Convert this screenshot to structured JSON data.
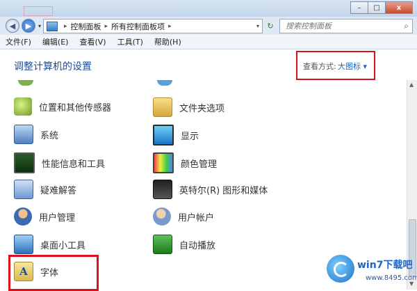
{
  "window": {
    "controls": [
      "–",
      "□",
      "x"
    ]
  },
  "address": {
    "path": [
      "控制面板",
      "所有控制面板项"
    ],
    "search_placeholder": "搜索控制面板"
  },
  "menu": [
    {
      "label": "文件(F)"
    },
    {
      "label": "编辑(E)"
    },
    {
      "label": "查看(V)"
    },
    {
      "label": "工具(T)"
    },
    {
      "label": "帮助(H)"
    }
  ],
  "header": {
    "title": "调整计算机的设置",
    "view_label": "查看方式:",
    "view_value": "大图标 ▾"
  },
  "items": [
    {
      "label": "位置和其他传感器",
      "icon": "location-sensor-icon"
    },
    {
      "label": "文件夹选项",
      "icon": "folder-options-icon"
    },
    {
      "label": "系统",
      "icon": "system-icon"
    },
    {
      "label": "显示",
      "icon": "display-icon"
    },
    {
      "label": "性能信息和工具",
      "icon": "performance-icon"
    },
    {
      "label": "颜色管理",
      "icon": "color-management-icon"
    },
    {
      "label": "疑难解答",
      "icon": "troubleshooting-icon"
    },
    {
      "label": "英特尔(R) 图形和媒体",
      "icon": "intel-graphics-icon"
    },
    {
      "label": "用户管理",
      "icon": "user-management-icon"
    },
    {
      "label": "用户帐户",
      "icon": "user-accounts-icon"
    },
    {
      "label": "桌面小工具",
      "icon": "desktop-gadgets-icon"
    },
    {
      "label": "自动播放",
      "icon": "autoplay-icon"
    },
    {
      "label": "字体",
      "icon": "fonts-icon"
    }
  ],
  "watermark": {
    "brand": "win7下载吧",
    "url": "www.8495.com"
  },
  "colors": {
    "accent_red": "#d9111b",
    "link_blue": "#1e63c9"
  }
}
